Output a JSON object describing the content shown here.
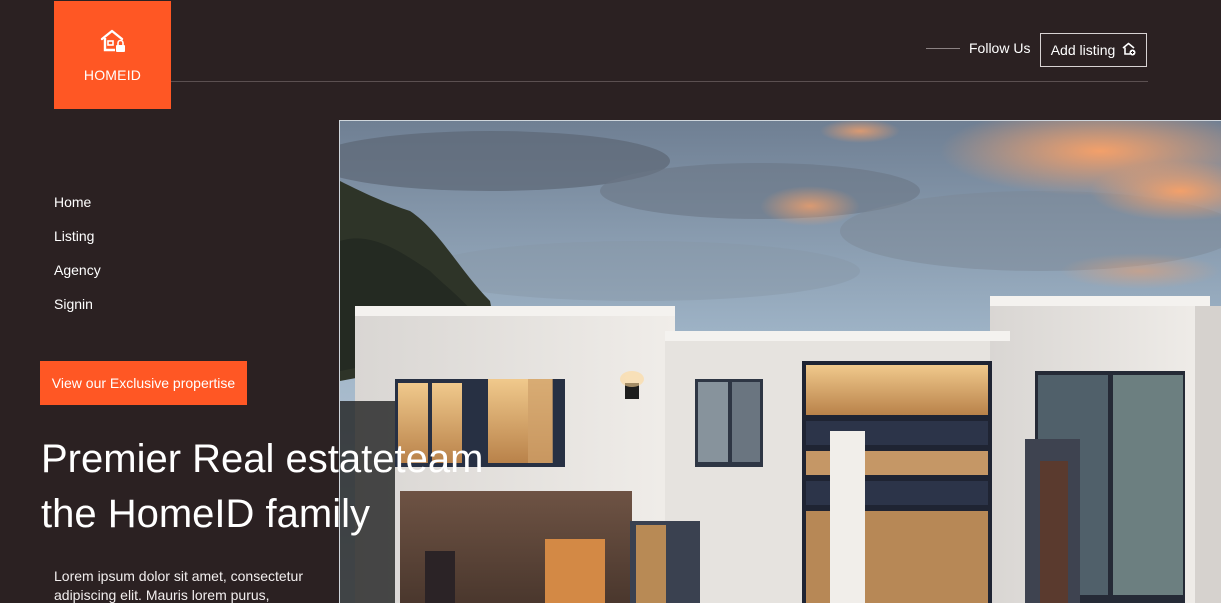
{
  "brand": {
    "name": "HOMEID",
    "logo_icon": "house-lock-icon",
    "accent": "#ff5724"
  },
  "header": {
    "follow_label": "Follow Us",
    "add_listing_label": "Add listing",
    "add_listing_icon": "house-add-icon"
  },
  "nav": {
    "items": [
      "Home",
      "Listing",
      "Agency",
      "Signin"
    ]
  },
  "hero": {
    "cta_label": "View our Exclusive propertise",
    "title_line1": "Premier Real estateteam",
    "title_line2": "the HomeID family",
    "description": "Lorem ipsum dolor sit amet, consectetur adipiscing elit. Mauris lorem purus,"
  },
  "colors": {
    "background": "#2b2122",
    "accent": "#ff5724"
  }
}
